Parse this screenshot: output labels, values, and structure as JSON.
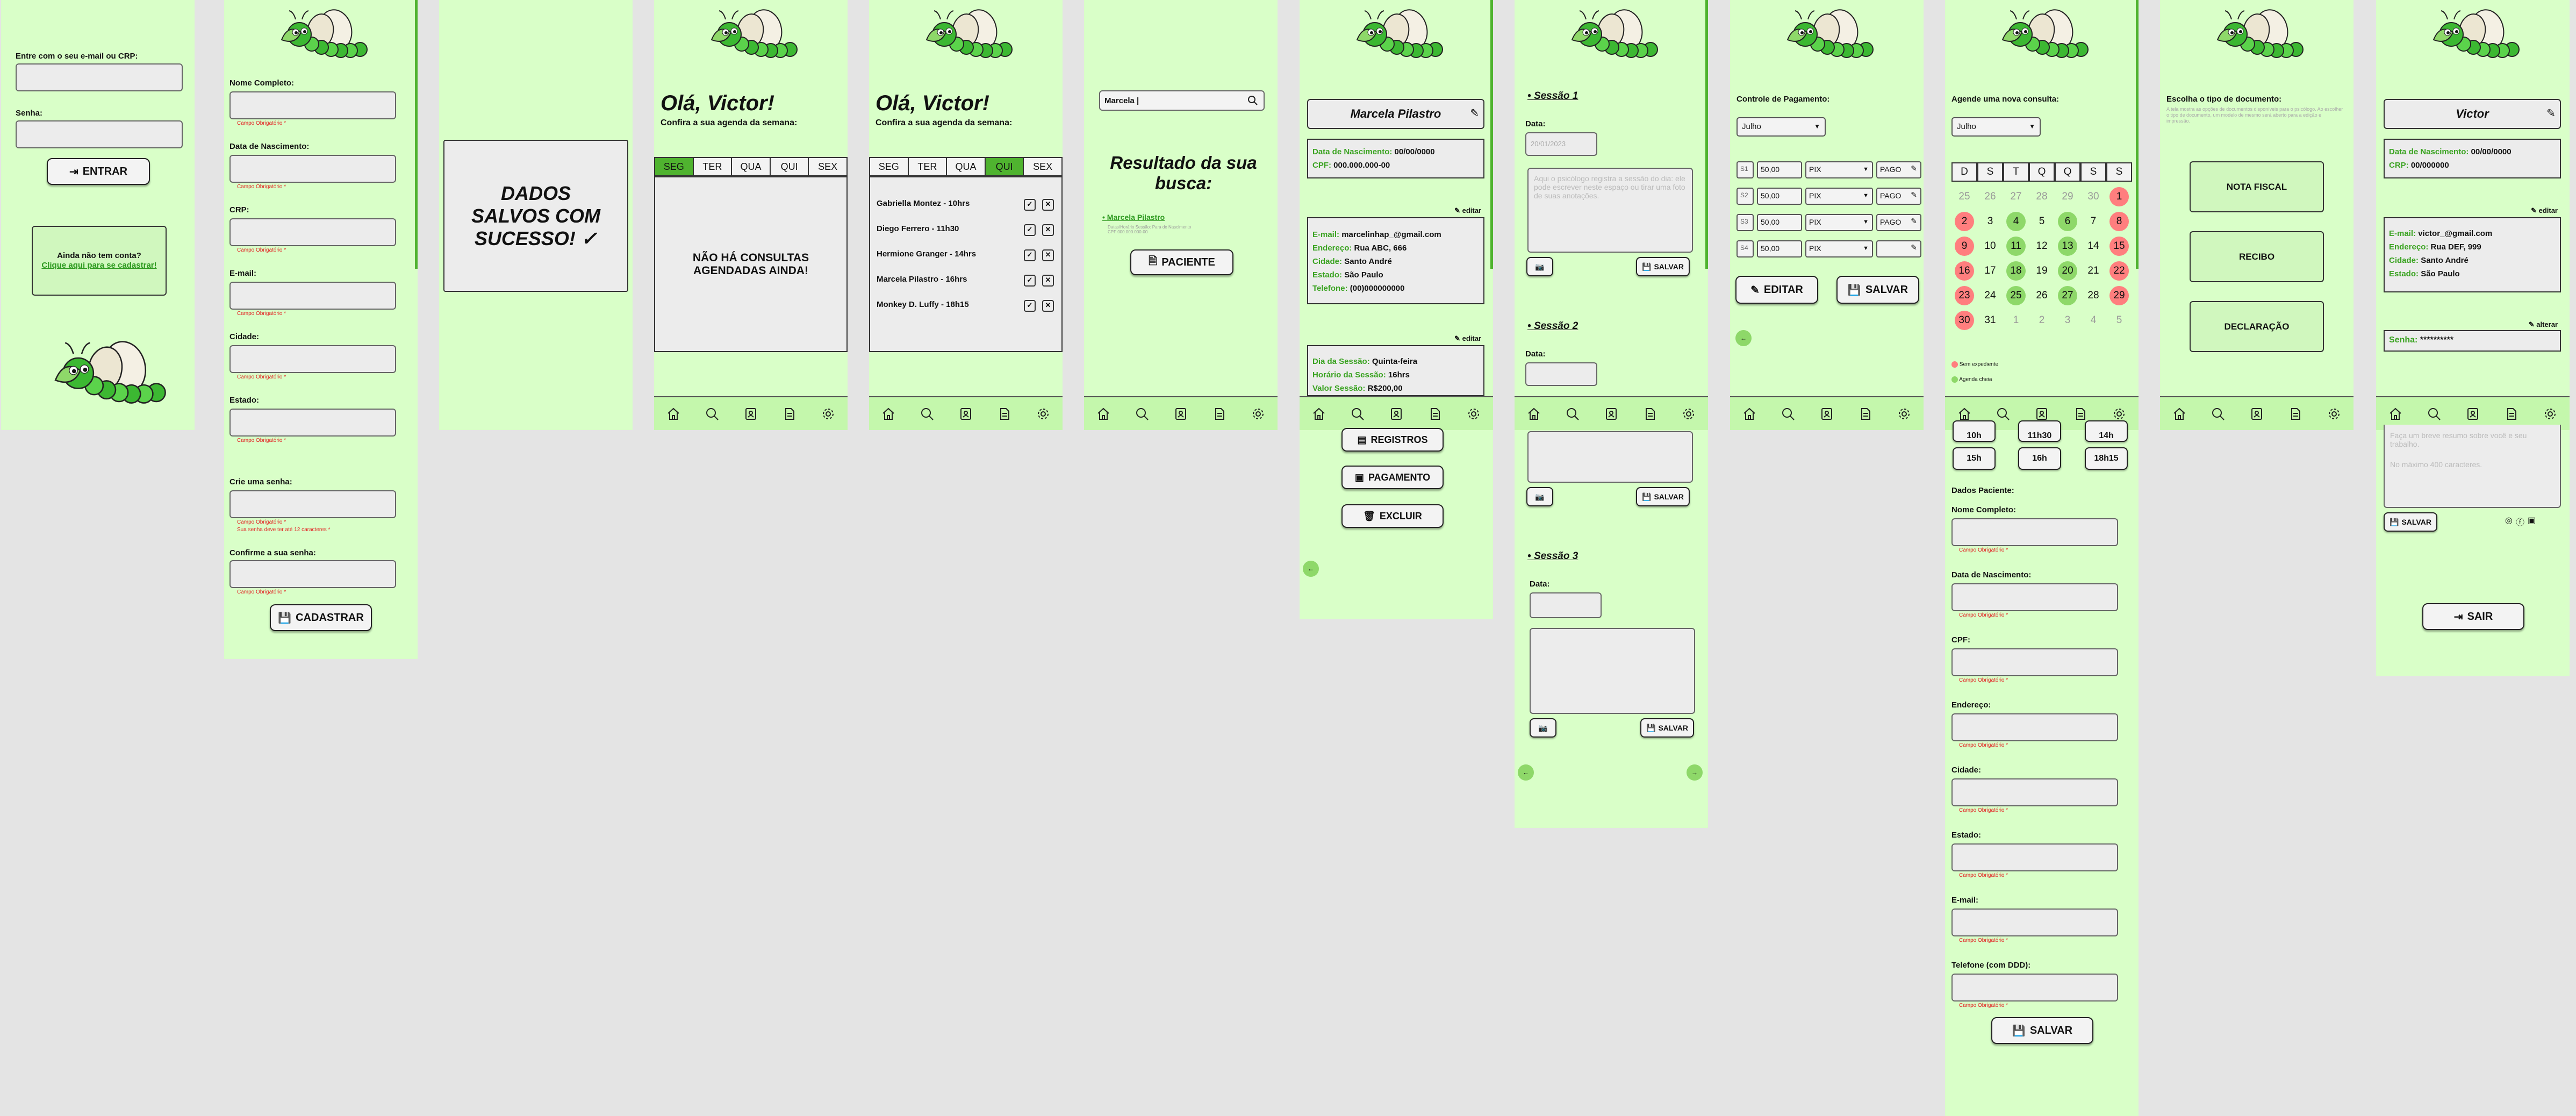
{
  "icons": [
    "home-icon",
    "search-icon",
    "contacts-icon",
    "document-icon",
    "gear-icon"
  ],
  "login": {
    "email_label": "Entre com o seu e-mail ou CRP:",
    "password_label": "Senha:",
    "enter": "ENTRAR",
    "no_account": "Ainda não tem conta?",
    "register_link": "Clique aqui para se cadastrar!"
  },
  "register": {
    "labels": [
      "Nome Completo:",
      "Data de Nascimento:",
      "CRP:",
      "E-mail:",
      "Cidade:",
      "Estado:"
    ],
    "required": "Campo Obrigatório *",
    "password_label": "Crie uma senha:",
    "password_hint": "Sua senha deve ter até 12 caracteres *",
    "confirm_label": "Confirme a sua senha:",
    "submit": "CADASTRAR"
  },
  "saved": {
    "message": "DADOS SALVOS COM SUCESSO! ✓"
  },
  "week_empty": {
    "greeting": "Olá, Victor!",
    "subtitle": "Confira a sua agenda da semana:",
    "days": [
      "SEG",
      "TER",
      "QUA",
      "QUI",
      "SEX"
    ],
    "empty": "NÃO HÁ CONSULTAS AGENDADAS AINDA!"
  },
  "week": {
    "greeting": "Olá, Victor!",
    "subtitle": "Confira a sua agenda da semana:",
    "days": [
      "SEG",
      "TER",
      "QUA",
      "QUI",
      "SEX"
    ],
    "appointments": [
      "Gabriella Montez - 10hrs",
      "Diego Ferrero - 11h30",
      "Hermione Granger - 14hrs",
      "Marcela Pilastro - 16hrs",
      "Monkey D. Luffy - 18h15"
    ]
  },
  "search": {
    "query": "Marcela |",
    "title": "Resultado da sua busca:",
    "result": "Marcela Pilastro",
    "result_detail": "Datas/Horário Sessão: Para de Nascimento\nCPF 000.000.000-00",
    "patient": "PACIENTE"
  },
  "patient": {
    "name": "Marcela Pilastro",
    "birth_label": "Data de Nascimento:",
    "birth": "00/00/0000",
    "cpf_label": "CPF:",
    "cpf": "000.000.000-00",
    "edit": "editar",
    "email_label": "E-mail:",
    "email": "marcelinhap_@gmail.com",
    "address_label": "Endereço:",
    "address": "Rua ABC, 666",
    "city_label": "Cidade:",
    "city": "Santo André",
    "state_label": "Estado:",
    "state": "São Paulo",
    "phone_label": "Telefone:",
    "phone": "(00)000000000",
    "session_day_label": "Dia da Sessão:",
    "session_day": "Quinta-feira",
    "session_time_label": "Horário da Sessão:",
    "session_time": "16hrs",
    "session_value_label": "Valor Sessão:",
    "session_value": "R$200,00",
    "records": "REGISTROS",
    "payment": "PAGAMENTO",
    "delete": "EXCLUIR"
  },
  "sessions": {
    "s1": "Sessão 1",
    "s2": "Sessão 2",
    "s3": "Sessão 3",
    "date_label": "Data:",
    "date1": "20/01/2023",
    "text_placeholder": "Aqui o psicólogo registra a sessão do dia: ele pode escrever neste espaço ou tirar uma foto de suas anotações.",
    "save": "SALVAR"
  },
  "payments": {
    "title": "Controle de Pagamento:",
    "month": "Julho",
    "rows": [
      {
        "id": "S1",
        "value": "50,00",
        "method": "PIX",
        "status": "PAGO"
      },
      {
        "id": "S2",
        "value": "50,00",
        "method": "PIX",
        "status": "PAGO"
      },
      {
        "id": "S3",
        "value": "50,00",
        "method": "PIX",
        "status": "PAGO"
      },
      {
        "id": "S4",
        "value": "50,00",
        "method": "PIX",
        "status": ""
      }
    ],
    "edit": "EDITAR",
    "save": "SALVAR"
  },
  "schedule": {
    "title": "Agende uma nova consulta:",
    "month": "Julho",
    "weekdays": [
      "D",
      "S",
      "T",
      "Q",
      "Q",
      "S",
      "S"
    ],
    "days": [
      [
        "25",
        "o"
      ],
      [
        "26",
        "o"
      ],
      [
        "27",
        "o"
      ],
      [
        "28",
        "o"
      ],
      [
        "29",
        "o"
      ],
      [
        "30",
        "o"
      ],
      [
        "1",
        "r"
      ],
      [
        "2",
        "r"
      ],
      [
        "3",
        ""
      ],
      [
        "4",
        "gr"
      ],
      [
        "5",
        ""
      ],
      [
        "6",
        "gr"
      ],
      [
        "7",
        ""
      ],
      [
        "8",
        "r"
      ],
      [
        "9",
        "r"
      ],
      [
        "10",
        ""
      ],
      [
        "11",
        "gr"
      ],
      [
        "12",
        ""
      ],
      [
        "13",
        "gr"
      ],
      [
        "14",
        ""
      ],
      [
        "15",
        "r"
      ],
      [
        "16",
        "r"
      ],
      [
        "17",
        ""
      ],
      [
        "18",
        "gr"
      ],
      [
        "19",
        ""
      ],
      [
        "20",
        "gr"
      ],
      [
        "21",
        ""
      ],
      [
        "22",
        "r"
      ],
      [
        "23",
        "r"
      ],
      [
        "24",
        ""
      ],
      [
        "25",
        "gr"
      ],
      [
        "26",
        ""
      ],
      [
        "27",
        "gr"
      ],
      [
        "28",
        ""
      ],
      [
        "29",
        "r"
      ],
      [
        "30",
        "r"
      ],
      [
        "31",
        ""
      ],
      [
        "1",
        "o"
      ],
      [
        "2",
        "o"
      ],
      [
        "3",
        "o"
      ],
      [
        "4",
        "o"
      ],
      [
        "5",
        "o"
      ]
    ],
    "legend_off": "Sem expediente",
    "legend_full": "Agenda cheia",
    "times_top": [
      "10h",
      "11h30",
      "14h"
    ],
    "times": [
      "15h",
      "16h",
      "18h15"
    ],
    "patient_data": "Dados Paciente:",
    "labels": [
      "Nome Completo:",
      "Data de Nascimento:",
      "CPF:",
      "Endereço:",
      "Cidade:",
      "Estado:",
      "E-mail:",
      "Telefone (com DDD):"
    ],
    "required": "Campo Obrigatório *",
    "save": "SALVAR"
  },
  "documents": {
    "title": "Escolha o tipo de documento:",
    "hint": "A tela mostra as opções de documentos disponíveis para o psicólogo. Ao escolher o tipo de documento, um modelo de mesmo será aberto para a edição e impressão.",
    "options": [
      "NOTA FISCAL",
      "RECIBO",
      "DECLARAÇÃO"
    ]
  },
  "profile": {
    "name": "Victor",
    "birth_label": "Data de Nascimento:",
    "birth": "00/00/0000",
    "crp_label": "CRP:",
    "crp": "00/000000",
    "edit": "editar",
    "email_label": "E-mail:",
    "email": "victor_@gmail.com",
    "address_label": "Endereço:",
    "address": "Rua DEF, 999",
    "city_label": "Cidade:",
    "city": "Santo André",
    "state_label": "Estado:",
    "state": "São Paulo",
    "change": "alterar",
    "password_label": "Senha:",
    "password": "**********",
    "bio_placeholder": "Faça um breve resumo sobre você e seu trabalho.",
    "bio_limit": "No máximo 400 caracteres.",
    "save": "SALVAR",
    "logout": "SAIR"
  }
}
